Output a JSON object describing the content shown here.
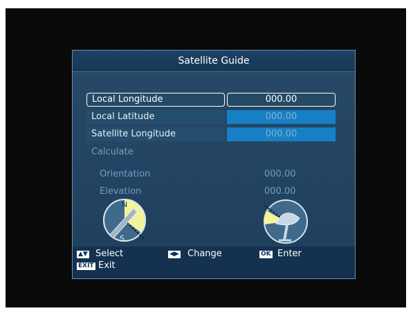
{
  "title": "Satellite Guide",
  "fields": {
    "local_longitude": {
      "label": "Local Longitude",
      "value": "000.00"
    },
    "local_latitude": {
      "label": "Local Latitude",
      "value": "000.00"
    },
    "satellite_longitude": {
      "label": "Satellite Longitude",
      "value": "000.00"
    }
  },
  "calculate_label": "Calculate",
  "results": {
    "orientation": {
      "label": "Orientation",
      "value": "000.00"
    },
    "elevation": {
      "label": "Elevation",
      "value": "000.00"
    }
  },
  "compass": {
    "north": "N",
    "south": "S"
  },
  "help": {
    "select": {
      "key": "▲▼",
      "label": "Select"
    },
    "change": {
      "key": "◀▶",
      "label": "Change"
    },
    "ok": {
      "key": "OK",
      "label": "Enter"
    },
    "exit": {
      "key": "EXIT",
      "label": "Exit"
    }
  },
  "colors": {
    "panel": "#274a68",
    "value_field": "#1780c5",
    "dim_text": "#6f9fc3",
    "accent_yellow": "#f3f39b"
  }
}
